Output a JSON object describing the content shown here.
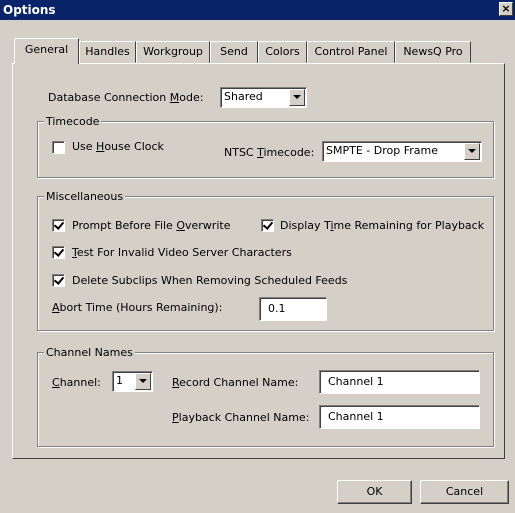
{
  "window": {
    "title": "Options",
    "close_glyph": "×"
  },
  "tabs": [
    {
      "label": "General",
      "active": true
    },
    {
      "label": "Handles"
    },
    {
      "label": "Workgroup"
    },
    {
      "label": "Send"
    },
    {
      "label": "Colors"
    },
    {
      "label": "Control Panel"
    },
    {
      "label": "NewsQ Pro"
    }
  ],
  "db": {
    "label_pre": "Database Connection ",
    "label_u": "M",
    "label_post": "ode:",
    "value": "Shared"
  },
  "timecode": {
    "title": "Timecode",
    "house_clock": {
      "pre": "Use ",
      "u": "H",
      "post": "ouse Clock",
      "checked": false
    },
    "ntsc": {
      "pre": "NTSC ",
      "u": "T",
      "post": "imecode:",
      "value": "SMPTE - Drop Frame"
    }
  },
  "misc": {
    "title": "Miscellaneous",
    "prompt": {
      "pre": "Prompt Before File ",
      "u": "O",
      "post": "verwrite",
      "checked": true
    },
    "display": {
      "pre": "Display T",
      "u": "i",
      "post": "me Remaining for Playback",
      "checked": true
    },
    "test": {
      "pre": "",
      "u": "T",
      "post": "est For Invalid Video Server Characters",
      "checked": true
    },
    "delete": {
      "pre": "Delete Subclips When Removing Scheduled Feeds",
      "u": "",
      "post": "",
      "checked": true
    },
    "abort": {
      "pre": "",
      "u": "A",
      "post": "bort Time (Hours Remaining):",
      "value": "0.1"
    }
  },
  "channels": {
    "title": "Channel Names",
    "channel": {
      "pre": "",
      "u": "C",
      "post": "hannel:",
      "value": "1"
    },
    "record": {
      "pre": "",
      "u": "R",
      "post": "ecord Channel Name:",
      "value": "Channel 1"
    },
    "playback": {
      "pre": "",
      "u": "P",
      "post": "layback Channel Name:",
      "value": "Channel 1"
    }
  },
  "buttons": {
    "ok": "OK",
    "cancel": "Cancel"
  }
}
